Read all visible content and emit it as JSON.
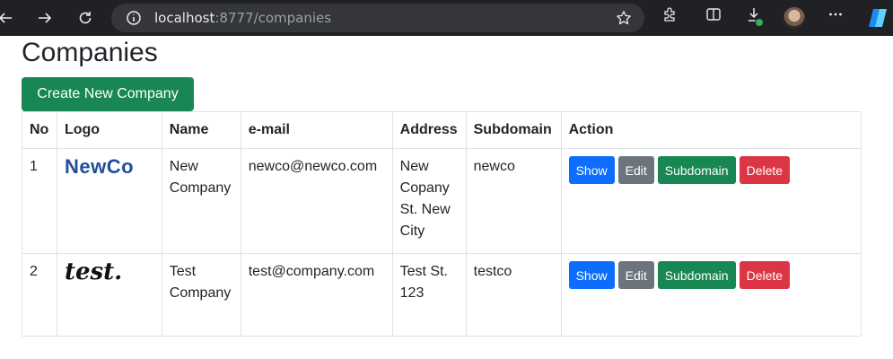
{
  "browser": {
    "url_host": "localhost",
    "url_rest": ":8777/companies"
  },
  "page": {
    "title": "Companies",
    "create_button": "Create New Company"
  },
  "table": {
    "headers": [
      "No",
      "Logo",
      "Name",
      "e-mail",
      "Address",
      "Subdomain",
      "Action"
    ],
    "rows": [
      {
        "no": "1",
        "logo_text": "NewCo",
        "name_line1": "New",
        "name_line2": "Company",
        "email": "newco@newco.com",
        "address": [
          "New",
          "Copany",
          "St. New",
          "City"
        ],
        "subdomain": "newco"
      },
      {
        "no": "2",
        "logo_text": "test.",
        "name_line1": "Test",
        "name_line2": "Company",
        "email": "test@company.com",
        "address": [
          "Test St.",
          "123"
        ],
        "subdomain": "testco"
      }
    ],
    "actions": {
      "show": "Show",
      "edit": "Edit",
      "subdomain": "Subdomain",
      "delete": "Delete"
    }
  },
  "colors": {
    "success": "#198754",
    "primary": "#0d6efd",
    "secondary": "#6c757d",
    "danger": "#dc3545"
  }
}
